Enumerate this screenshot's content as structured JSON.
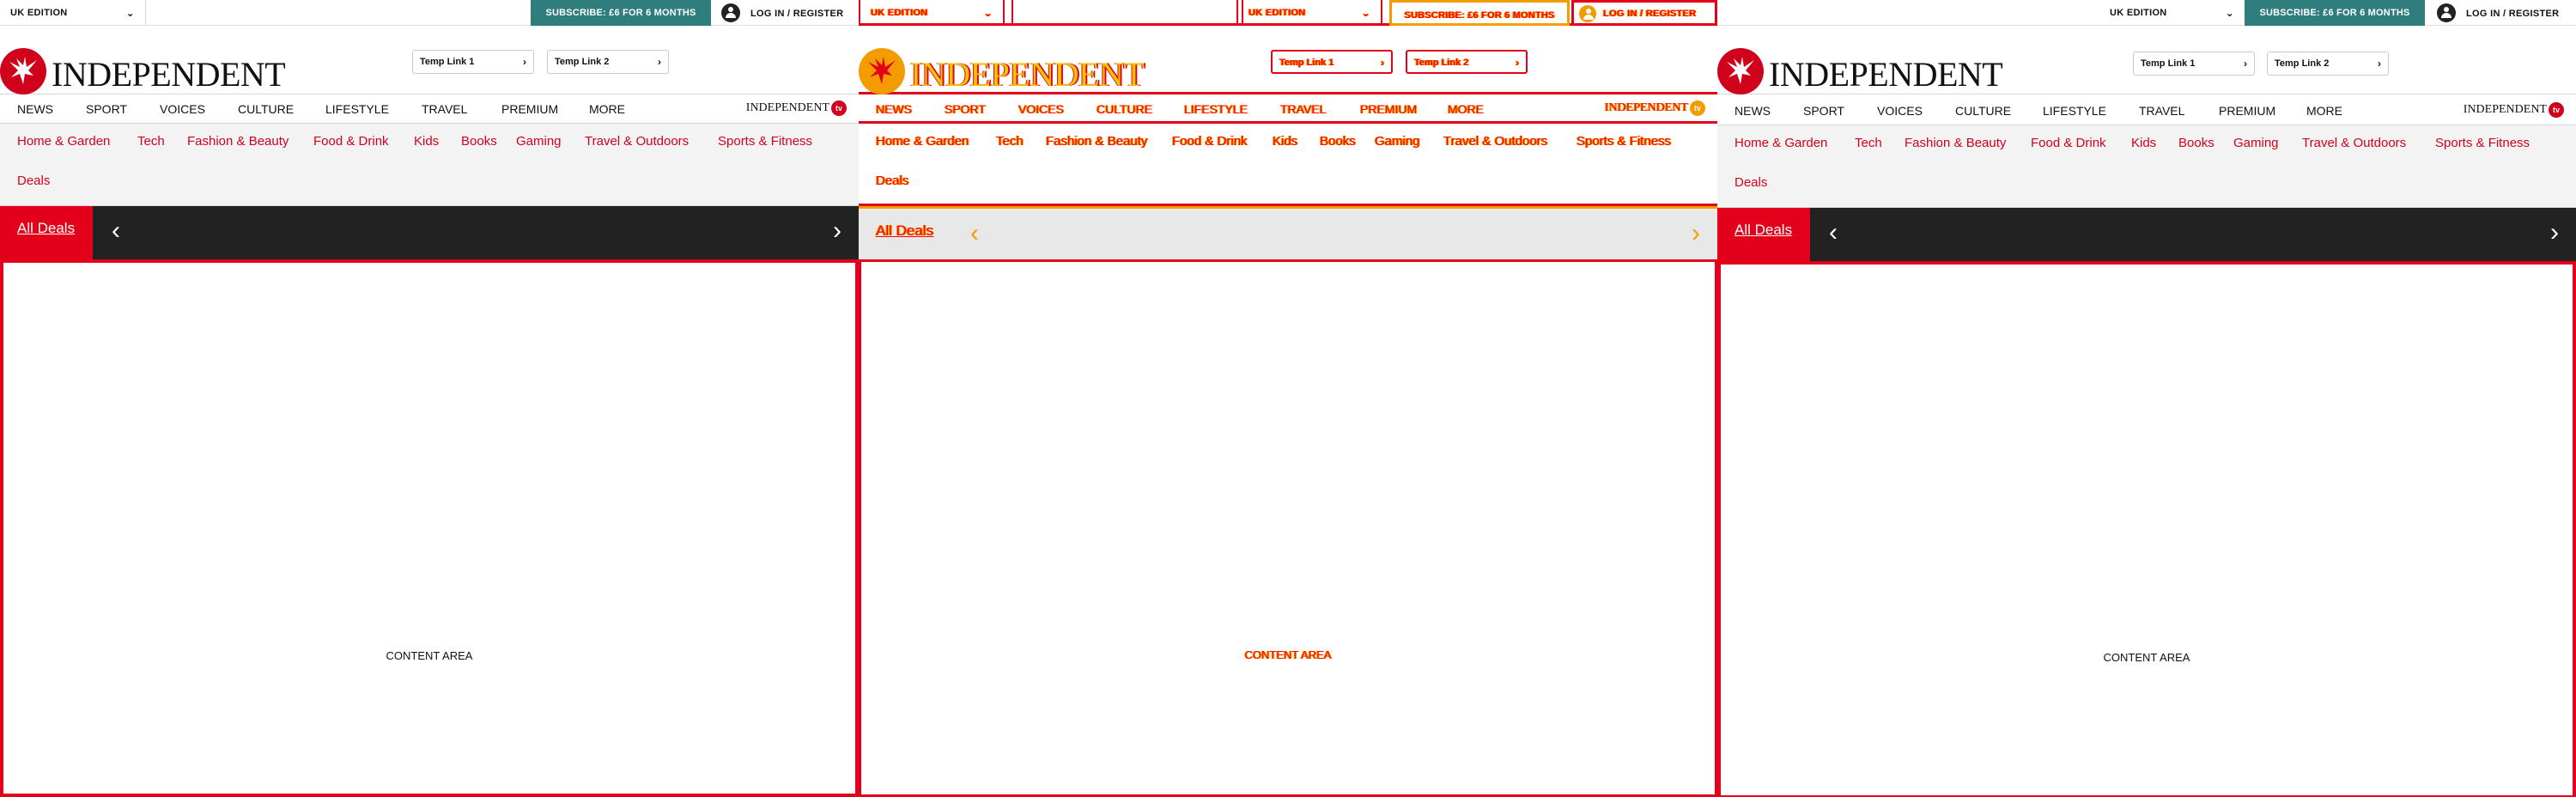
{
  "topbar": {
    "edition_label": "UK EDITION",
    "subscribe_label": "SUBSCRIBE: £6 FOR 6 MONTHS",
    "login_label": "LOG IN / REGISTER"
  },
  "masthead": {
    "logo_text": "INDEPENDENT",
    "temp_links": [
      "Temp Link 1",
      "Temp Link 2"
    ]
  },
  "main_nav": {
    "items": [
      "NEWS",
      "SPORT",
      "VOICES",
      "CULTURE",
      "LIFESTYLE",
      "TRAVEL",
      "PREMIUM",
      "MORE"
    ],
    "itv_label": "INDEPENDENT",
    "itv_badge": "tv"
  },
  "sub_nav": {
    "items": [
      "Home & Garden",
      "Tech",
      "Fashion & Beauty",
      "Food & Drink",
      "Kids",
      "Books",
      "Gaming",
      "Travel & Outdoors",
      "Sports & Fitness",
      "Deals"
    ]
  },
  "deals_bar": {
    "all_deals_label": "All Deals",
    "prev_arrow": "‹",
    "next_arrow": "›"
  },
  "content": {
    "label": "CONTENT AREA"
  },
  "colors": {
    "brand_red": "#d0021b",
    "deals_red": "#e3001b",
    "subscribe_teal": "#2f7d7c",
    "diff_orange": "#f39c00",
    "diff_yellow": "#f7c300"
  }
}
